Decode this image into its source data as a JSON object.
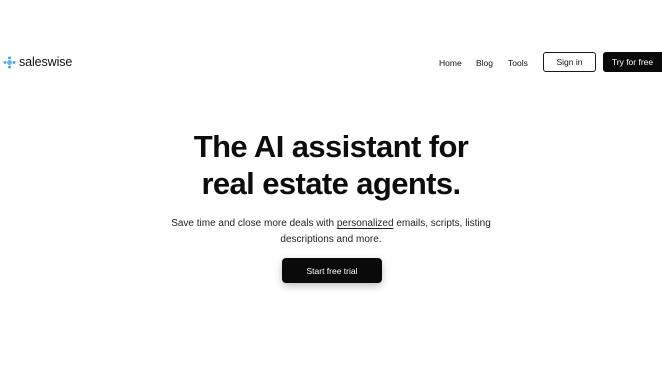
{
  "brand": {
    "name": "saleswise",
    "icon": "sparkle-cross-icon",
    "icon_color": "#3aa0d8"
  },
  "nav": {
    "home": "Home",
    "blog": "Blog",
    "tools": "Tools",
    "sign_in": "Sign in",
    "try_free": "Try for free"
  },
  "hero": {
    "title_line1": "The AI assistant for",
    "title_line2": "real estate agents.",
    "subtitle_before": "Save time and close more deals with ",
    "subtitle_link": "personalized",
    "subtitle_after": " emails, scripts, listing",
    "subtitle_line2": "descriptions and more.",
    "cta": "Start free trial"
  },
  "colors": {
    "background": "#ffffff",
    "text": "#111111",
    "button_dark": "#0a0a0a"
  }
}
